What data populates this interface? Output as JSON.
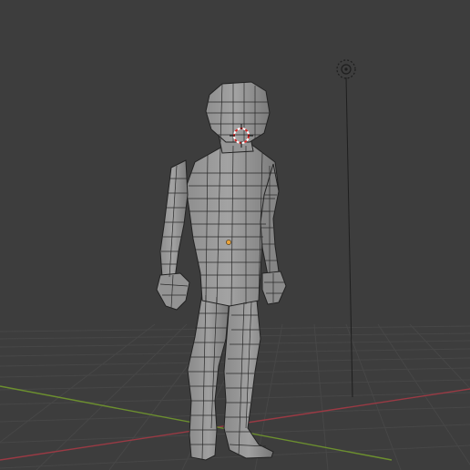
{
  "viewport": {
    "kind": "3d-viewport",
    "background_color": "#3d3d3d",
    "grid_color": "#474747",
    "x_axis_color": "#9a3a44",
    "y_axis_color": "#6c8f2f"
  },
  "scene": {
    "objects": [
      {
        "name": "character-mesh",
        "icon": "humanoid-mesh-icon",
        "color": "#9b9b9b",
        "wire_color": "#1f1f1f"
      },
      {
        "name": "light",
        "icon": "light-icon"
      },
      {
        "name": "3d-cursor",
        "icon": "3d-cursor-icon"
      },
      {
        "name": "object-origin",
        "icon": "origin-dot-icon",
        "color": "#e8a23b"
      }
    ]
  }
}
